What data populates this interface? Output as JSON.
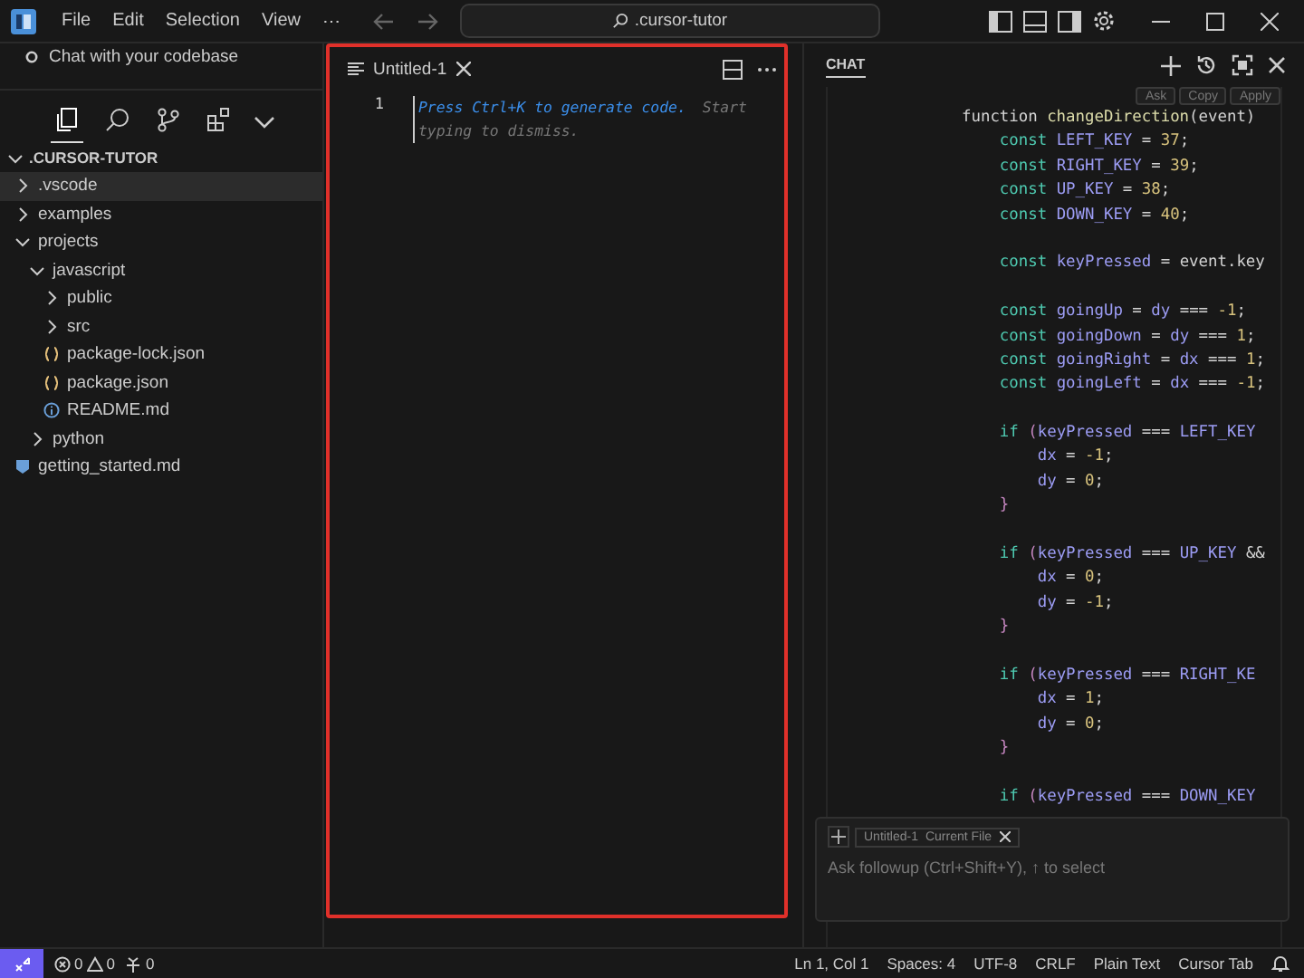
{
  "menu": [
    "File",
    "Edit",
    "Selection",
    "View",
    "⋯"
  ],
  "search": {
    "value": ".cursor-tutor"
  },
  "sidebar": {
    "hint": "Chat with your codebase",
    "activity_tabs": [
      {
        "selected": true
      },
      {
        "selected": false
      },
      {
        "selected": false
      },
      {
        "selected": false
      }
    ]
  },
  "explorer": {
    "title": ".CURSOR-TUTOR",
    "expanded": true,
    "items": [
      {
        "name": ".vscode",
        "kind": "folder",
        "expanded": false,
        "selected": true
      },
      {
        "name": "examples",
        "kind": "folder",
        "expanded": false,
        "selected": false
      },
      {
        "name": "projects",
        "kind": "folder",
        "expanded": true,
        "selected": false,
        "children": [
          {
            "name": "javascript",
            "kind": "folder",
            "expanded": true,
            "selected": false,
            "children": [
              {
                "name": "public",
                "kind": "folder",
                "expanded": false,
                "selected": false
              },
              {
                "name": "src",
                "kind": "folder",
                "expanded": false,
                "selected": false
              },
              {
                "name": "package-lock.json",
                "kind": "json",
                "selected": false
              },
              {
                "name": "package.json",
                "kind": "json",
                "selected": false
              },
              {
                "name": "README.md",
                "kind": "info",
                "selected": false
              }
            ]
          },
          {
            "name": "python",
            "kind": "folder",
            "expanded": false,
            "selected": false
          }
        ]
      },
      {
        "name": "getting_started.md",
        "kind": "markdown",
        "selected": false
      }
    ]
  },
  "editor": {
    "tab": "Untitled-1",
    "line_number": "1",
    "hint": "Press Ctrl+K to generate code.",
    "hint_more": "Start typing to dismiss."
  },
  "chat": {
    "title": "CHAT",
    "code_actions": [
      "Ask",
      "Copy",
      "Apply"
    ],
    "code": [
      {
        "kind": "code",
        "tokens": [
          {
            "kind": "plain",
            "text": "function "
          },
          {
            "kind": "fn",
            "text": "changeDirection"
          },
          {
            "kind": "plain",
            "text": "(event)"
          }
        ]
      },
      {
        "kind": "code",
        "tokens": [
          {
            "kind": "kw",
            "text": "    const "
          },
          {
            "kind": "id",
            "text": "LEFT_KEY"
          },
          {
            "kind": "plain",
            "text": " = "
          },
          {
            "kind": "num",
            "text": "37"
          },
          {
            "kind": "plain",
            "text": ";"
          }
        ]
      },
      {
        "kind": "code",
        "tokens": [
          {
            "kind": "kw",
            "text": "    const "
          },
          {
            "kind": "id",
            "text": "RIGHT_KEY"
          },
          {
            "kind": "plain",
            "text": " = "
          },
          {
            "kind": "num",
            "text": "39"
          },
          {
            "kind": "plain",
            "text": ";"
          }
        ]
      },
      {
        "kind": "code",
        "tokens": [
          {
            "kind": "kw",
            "text": "    const "
          },
          {
            "kind": "id",
            "text": "UP_KEY"
          },
          {
            "kind": "plain",
            "text": " = "
          },
          {
            "kind": "num",
            "text": "38"
          },
          {
            "kind": "plain",
            "text": ";"
          }
        ]
      },
      {
        "kind": "code",
        "tokens": [
          {
            "kind": "kw",
            "text": "    const "
          },
          {
            "kind": "id",
            "text": "DOWN_KEY"
          },
          {
            "kind": "plain",
            "text": " = "
          },
          {
            "kind": "num",
            "text": "40"
          },
          {
            "kind": "plain",
            "text": ";"
          }
        ]
      },
      {
        "kind": "blank"
      },
      {
        "kind": "code",
        "tokens": [
          {
            "kind": "kw",
            "text": "    const "
          },
          {
            "kind": "id",
            "text": "keyPressed"
          },
          {
            "kind": "plain",
            "text": " = event.key"
          }
        ]
      },
      {
        "kind": "blank"
      },
      {
        "kind": "code",
        "tokens": [
          {
            "kind": "kw",
            "text": "    const "
          },
          {
            "kind": "id",
            "text": "goingUp"
          },
          {
            "kind": "plain",
            "text": " = "
          },
          {
            "kind": "id",
            "text": "dy"
          },
          {
            "kind": "plain",
            "text": " === "
          },
          {
            "kind": "num",
            "text": "-1"
          },
          {
            "kind": "plain",
            "text": ";"
          }
        ]
      },
      {
        "kind": "code",
        "tokens": [
          {
            "kind": "kw",
            "text": "    const "
          },
          {
            "kind": "id",
            "text": "goingDown"
          },
          {
            "kind": "plain",
            "text": " = "
          },
          {
            "kind": "id",
            "text": "dy"
          },
          {
            "kind": "plain",
            "text": " === "
          },
          {
            "kind": "num",
            "text": "1"
          },
          {
            "kind": "plain",
            "text": ";"
          }
        ]
      },
      {
        "kind": "code",
        "tokens": [
          {
            "kind": "kw",
            "text": "    const "
          },
          {
            "kind": "id",
            "text": "goingRight"
          },
          {
            "kind": "plain",
            "text": " = "
          },
          {
            "kind": "id",
            "text": "dx"
          },
          {
            "kind": "plain",
            "text": " === "
          },
          {
            "kind": "num",
            "text": "1"
          },
          {
            "kind": "plain",
            "text": ";"
          }
        ]
      },
      {
        "kind": "code",
        "tokens": [
          {
            "kind": "kw",
            "text": "    const "
          },
          {
            "kind": "id",
            "text": "goingLeft"
          },
          {
            "kind": "plain",
            "text": " = "
          },
          {
            "kind": "id",
            "text": "dx"
          },
          {
            "kind": "plain",
            "text": " === "
          },
          {
            "kind": "num",
            "text": "-1"
          },
          {
            "kind": "plain",
            "text": ";"
          }
        ]
      },
      {
        "kind": "blank"
      },
      {
        "kind": "code",
        "tokens": [
          {
            "kind": "kw",
            "text": "    if "
          },
          {
            "kind": "paren",
            "text": "("
          },
          {
            "kind": "id",
            "text": "keyPressed"
          },
          {
            "kind": "plain",
            "text": " === "
          },
          {
            "kind": "id",
            "text": "LEFT_KEY"
          }
        ]
      },
      {
        "kind": "code",
        "tokens": [
          {
            "kind": "id",
            "text": "        dx"
          },
          {
            "kind": "plain",
            "text": " = "
          },
          {
            "kind": "num",
            "text": "-1"
          },
          {
            "kind": "plain",
            "text": ";"
          }
        ]
      },
      {
        "kind": "code",
        "tokens": [
          {
            "kind": "id",
            "text": "        dy"
          },
          {
            "kind": "plain",
            "text": " = "
          },
          {
            "kind": "num",
            "text": "0"
          },
          {
            "kind": "plain",
            "text": ";"
          }
        ]
      },
      {
        "kind": "code",
        "tokens": [
          {
            "kind": "paren",
            "text": "    }"
          }
        ]
      },
      {
        "kind": "blank"
      },
      {
        "kind": "code",
        "tokens": [
          {
            "kind": "kw",
            "text": "    if "
          },
          {
            "kind": "paren",
            "text": "("
          },
          {
            "kind": "id",
            "text": "keyPressed"
          },
          {
            "kind": "plain",
            "text": " === "
          },
          {
            "kind": "id",
            "text": "UP_KEY"
          },
          {
            "kind": "plain",
            "text": " &&"
          }
        ]
      },
      {
        "kind": "code",
        "tokens": [
          {
            "kind": "id",
            "text": "        dx"
          },
          {
            "kind": "plain",
            "text": " = "
          },
          {
            "kind": "num",
            "text": "0"
          },
          {
            "kind": "plain",
            "text": ";"
          }
        ]
      },
      {
        "kind": "code",
        "tokens": [
          {
            "kind": "id",
            "text": "        dy"
          },
          {
            "kind": "plain",
            "text": " = "
          },
          {
            "kind": "num",
            "text": "-1"
          },
          {
            "kind": "plain",
            "text": ";"
          }
        ]
      },
      {
        "kind": "code",
        "tokens": [
          {
            "kind": "paren",
            "text": "    }"
          }
        ]
      },
      {
        "kind": "blank"
      },
      {
        "kind": "code",
        "tokens": [
          {
            "kind": "kw",
            "text": "    if "
          },
          {
            "kind": "paren",
            "text": "("
          },
          {
            "kind": "id",
            "text": "keyPressed"
          },
          {
            "kind": "plain",
            "text": " === "
          },
          {
            "kind": "id",
            "text": "RIGHT_KE"
          }
        ]
      },
      {
        "kind": "code",
        "tokens": [
          {
            "kind": "id",
            "text": "        dx"
          },
          {
            "kind": "plain",
            "text": " = "
          },
          {
            "kind": "num",
            "text": "1"
          },
          {
            "kind": "plain",
            "text": ";"
          }
        ]
      },
      {
        "kind": "code",
        "tokens": [
          {
            "kind": "id",
            "text": "        dy"
          },
          {
            "kind": "plain",
            "text": " = "
          },
          {
            "kind": "num",
            "text": "0"
          },
          {
            "kind": "plain",
            "text": ";"
          }
        ]
      },
      {
        "kind": "code",
        "tokens": [
          {
            "kind": "paren",
            "text": "    }"
          }
        ]
      },
      {
        "kind": "blank"
      },
      {
        "kind": "code",
        "tokens": [
          {
            "kind": "kw",
            "text": "    if "
          },
          {
            "kind": "paren",
            "text": "("
          },
          {
            "kind": "id",
            "text": "keyPressed"
          },
          {
            "kind": "plain",
            "text": " === "
          },
          {
            "kind": "id",
            "text": "DOWN_KEY"
          }
        ]
      }
    ],
    "context_chip": {
      "name": "Untitled-1",
      "note": "Current File"
    },
    "input": {
      "placeholder": "Ask followup (Ctrl+Shift+Y), ↑ to select"
    }
  },
  "status_bar": {
    "errors": "0",
    "warnings": "0",
    "ports": "0",
    "right": [
      "Ln 1, Col 1",
      "Spaces: 4",
      "UTF-8",
      "CRLF",
      "Plain Text",
      "Cursor Tab"
    ]
  }
}
